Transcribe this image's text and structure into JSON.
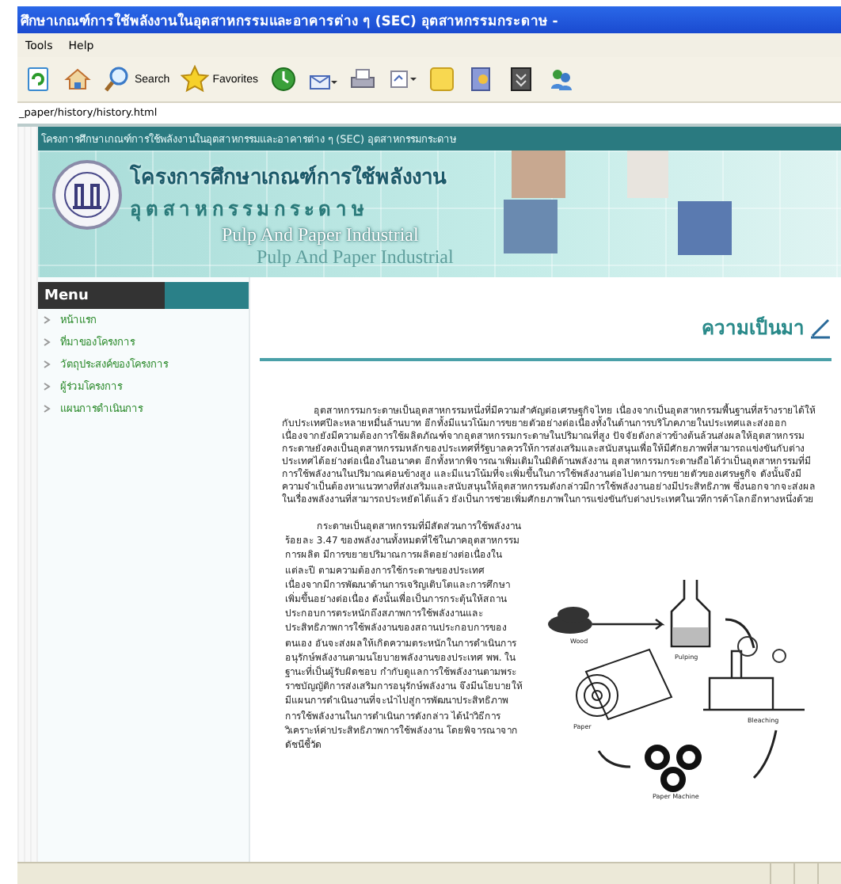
{
  "window": {
    "title": "ศึกษาเกณฑ์การใช้พลังงานในอุตสาหกรรมและอาคารต่าง ๆ (SEC) อุตสาหกรรมกระดาษ -"
  },
  "menu_bar": [
    "Tools",
    "Help"
  ],
  "toolbar": [
    {
      "kind": "refresh"
    },
    {
      "kind": "home"
    },
    {
      "kind": "search",
      "label": "Search"
    },
    {
      "kind": "favorites",
      "label": "Favorites"
    },
    {
      "kind": "history"
    },
    {
      "kind": "mail"
    },
    {
      "kind": "print"
    },
    {
      "kind": "edit"
    },
    {
      "kind": "note"
    },
    {
      "kind": "research"
    },
    {
      "kind": "archive"
    },
    {
      "kind": "messenger"
    }
  ],
  "address": {
    "value": "_paper/history/history.html"
  },
  "page": {
    "header_bar": "โครงการศึกษาเกณฑ์การใช้พลังงานในอุตสาหกรรมและอาคารต่าง ๆ (SEC) อุตสาหกรรมกระดาษ",
    "banner": {
      "title": "โครงการศึกษาเกณฑ์การใช้พลังงาน",
      "subtitle": "อุตสาหกรรมกระดาษ",
      "english": "Pulp And Paper Industrial",
      "english_faded": "Pulp And Paper Industrial"
    },
    "menu": {
      "title": "Menu",
      "items": [
        "หน้าแรก",
        "ที่มาของโครงการ",
        "วัตถุประสงค์ของโครงการ",
        "ผู้ร่วมโครงการ",
        "แผนการดำเนินการ"
      ]
    },
    "heading": "ความเป็นมา",
    "paragraphs": [
      "อุตสาหกรรมกระดาษเป็นอุตสาหกรรมหนึ่งที่มีความสำคัญต่อเศรษฐกิจไทย เนื่องจากเป็นอุตสาหกรรมพื้นฐานที่สร้างรายได้ให้กับประเทศปีละหลายหมื่นล้านบาท อีกทั้งมีแนวโน้มการขยายตัวอย่างต่อเนื่องทั้งในด้านการบริโภคภายในประเทศและส่งออก เนื่องจากยังมีความต้องการใช้ผลิตภัณฑ์จากอุตสาหกรรมกระดาษในปริมาณที่สูง ปัจจัยดังกล่าวข้างต้นล้วนส่งผลให้อุตสาหกรรมกระดาษยังคงเป็นอุตสาหกรรมหลักของประเทศที่รัฐบาลควรให้การส่งเสริมและสนับสนุนเพื่อให้มีศักยภาพที่สามารถแข่งขันกับต่างประเทศได้อย่างต่อเนื่องในอนาคต อีกทั้งหากพิจารณาเพิ่มเติมในมิติด้านพลังงาน อุตสาหกรรมกระดาษถือได้ว่าเป็นอุตสาหกรรมที่มีการใช้พลังงานในปริมาณค่อนข้างสูง และมีแนวโน้มที่จะเพิ่มขึ้นในการใช้พลังงานต่อไปตามการขยายตัวของเศรษฐกิจ ดังนั้นจึงมีความจำเป็นต้องหาแนวทางที่ส่งเสริมและสนับสนุนให้อุตสาหกรรมดังกล่าวมีการใช้พลังงานอย่างมีประสิทธิภาพ ซึ่งนอกจากจะส่งผลในเรื่องพลังงานที่สามารถประหยัดได้แล้ว ยังเป็นการช่วยเพิ่มศักยภาพในการแข่งขันกับต่างประเทศในเวทีการค้าโลกอีกทางหนึ่งด้วย",
      "กระดาษเป็นอุตสาหกรรมที่มีสัดส่วนการใช้พลังงาน ร้อยละ 3.47 ของพลังงานทั้งหมดที่ใช้ในภาคอุตสาหกรรมการผลิต มีการขยายปริมาณการผลิตอย่างต่อเนื่องในแต่ละปี ตามความต้องการใช้กระดาษของประเทศ เนื่องจากมีการพัฒนาด้านการเจริญเติบโตและการศึกษาเพิ่มขึ้นอย่างต่อเนื่อง ดังนั้นเพื่อเป็นการกระตุ้นให้สถานประกอบการตระหนักถึงสภาพการใช้พลังงานและประสิทธิภาพการใช้พลังงานของสถานประกอบการของตนเอง อันจะส่งผลให้เกิดความตระหนักในการดำเนินการอนุรักษ์พลังงานตามนโยบายพลังงานของประเทศ พพ. ในฐานะที่เป็นผู้รับผิดชอบ กำกับดูแลการใช้พลังงานตามพระราชบัญญัติการส่งเสริมการอนุรักษ์พลังงาน จึงมีนโยบายให้มีแผนการดำเนินงานที่จะนำไปสู่การพัฒนาประสิทธิภาพการใช้พลังงานในการดำเนินการดังกล่าว ได้นำวิธีการวิเคราะห์ค่าประสิทธิภาพการใช้พลังงาน โดยพิจารณาจากดัชนีชี้วัด"
    ],
    "diagram": {
      "labels": [
        "Wood",
        "Pulping",
        "Bleaching",
        "Paper Machine",
        "Paper"
      ]
    }
  }
}
